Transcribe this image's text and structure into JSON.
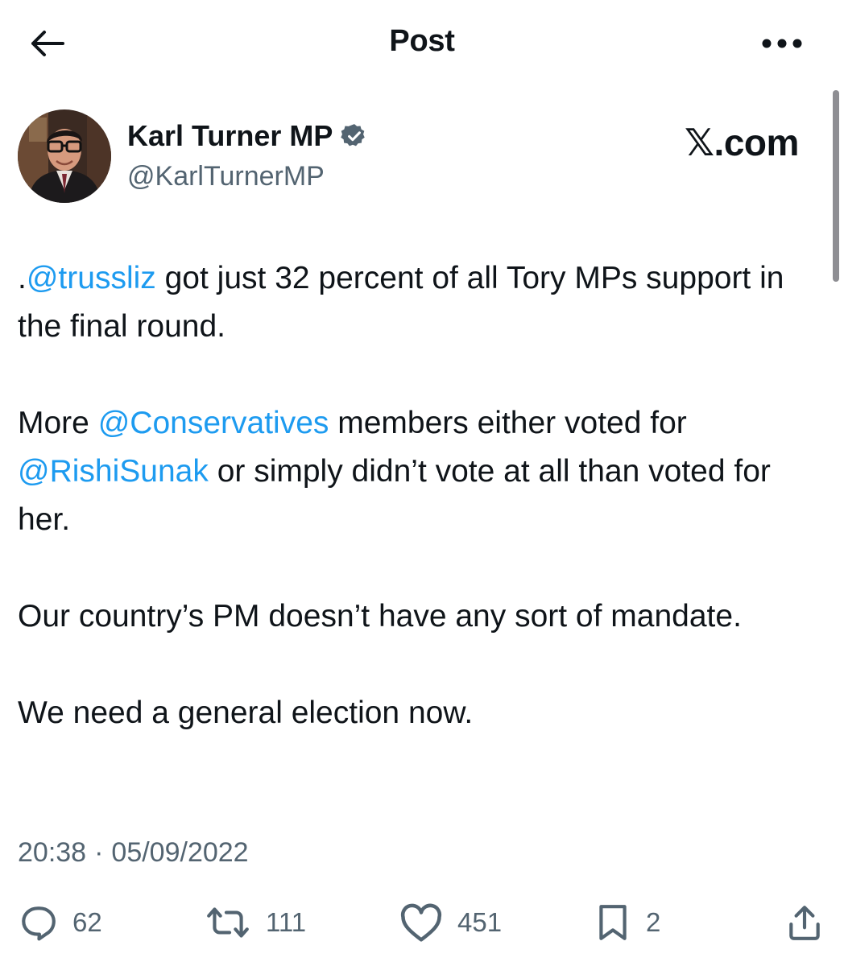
{
  "header": {
    "title": "Post",
    "back_icon": "arrow-left-icon",
    "more_icon": "more-dots-icon"
  },
  "author": {
    "name": "Karl Turner MP",
    "handle": "@KarlTurnerMP",
    "verified": true,
    "verified_color": "#536471"
  },
  "brand": {
    "label": "𝕏.com"
  },
  "tweet": {
    "p1": {
      "prefix": ".",
      "mention": "@trussliz",
      "text": " got just 32 percent of all Tory MPs support in the final round."
    },
    "p2": {
      "prefix": "More ",
      "mention1": "@Conservatives",
      "middle": " members either voted for ",
      "mention2": "@RishiSunak",
      "text": " or simply didn’t vote at all than voted for her."
    },
    "p3": "Our country’s PM doesn’t have any sort of mandate.",
    "p4": "We need a general election now."
  },
  "meta": {
    "time": "20:38",
    "separator": "·",
    "date": "05/09/2022"
  },
  "actions": {
    "replies": "62",
    "reposts": "111",
    "likes": "451",
    "bookmarks": "2",
    "share_icon": "share-icon"
  },
  "colors": {
    "link": "#1d9bf0",
    "text": "#0f1419",
    "secondary": "#536471"
  }
}
